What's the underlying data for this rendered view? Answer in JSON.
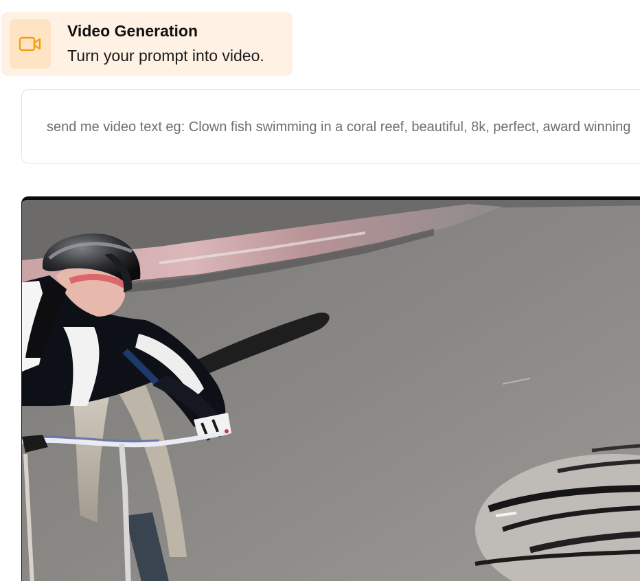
{
  "header": {
    "icon": "video-camera-icon",
    "title": "Video Generation",
    "subtitle": "Turn your prompt into video.",
    "accent_color": "#f59e0b",
    "card_background": "#fff1e3"
  },
  "prompt": {
    "placeholder": "send me video text eg: Clown fish swimming in a coral reef, beautiful, 8k, perfect, award winning",
    "value": ""
  },
  "video": {
    "description_icon": "video-player",
    "frame_border_color": "#0a0a0a"
  }
}
